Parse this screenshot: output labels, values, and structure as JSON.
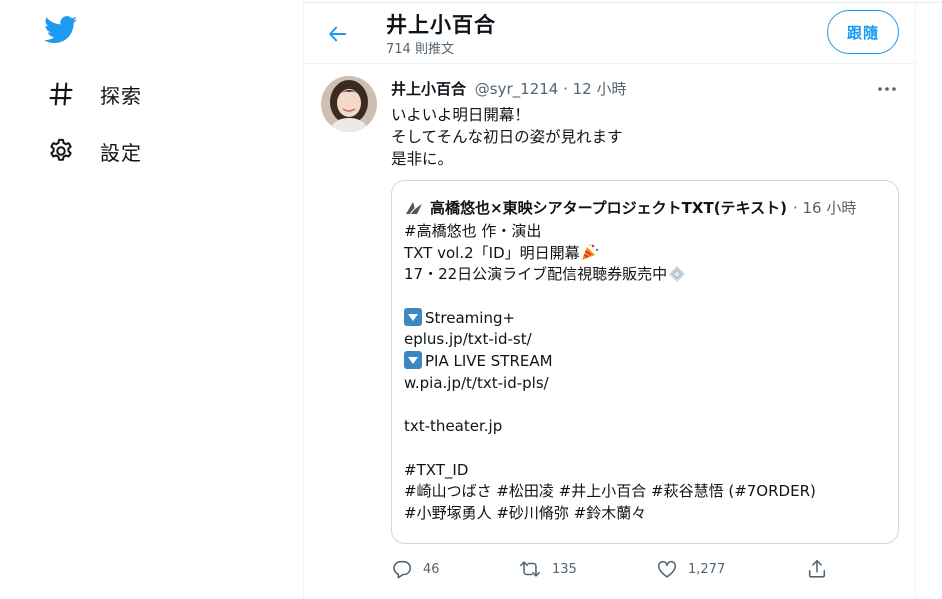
{
  "nav": {
    "logo_icon": "twitter-bird-icon",
    "items": [
      {
        "label": "探索",
        "icon": "hashtag-icon"
      },
      {
        "label": "設定",
        "icon": "gear-icon"
      }
    ]
  },
  "header": {
    "title": "井上小百合",
    "subtitle": "714 則推文",
    "follow_label": "跟隨",
    "back_icon": "arrow-left-icon"
  },
  "tweet": {
    "name": "井上小百合",
    "meta": "@syr_1214 · 12 小時",
    "more_icon": "more-horizontal-icon",
    "text_lines": [
      "いよいよ明日開幕！",
      "そしてそんな初日の姿が見れます",
      "是非に。"
    ],
    "quote": {
      "name": "高橋悠也×東映シアタープロジェクトTXT(テキスト)",
      "time": "· 16 小時",
      "lines": [
        "#高橋悠也 作・演出",
        "TXT vol.2「ID」明日開幕",
        "17・22日公演ライブ配信視聴券販売中",
        "",
        "Streaming+",
        "eplus.jp/txt-id-st/",
        "PIA LIVE STREAM",
        "w.pia.jp/t/txt-id-pls/",
        "",
        "txt-theater.jp",
        "",
        "#TXT_ID",
        "#崎山つばさ #松田凌 #井上小百合 #萩谷慧悟 (#7ORDER)",
        "#小野塚勇人 #砂川脩弥 #鈴木蘭々"
      ]
    },
    "actions": {
      "reply_count": "46",
      "retweet_count": "135",
      "like_count": "1,277"
    }
  },
  "colors": {
    "accent": "#1d9bf0",
    "text": "#0f1419",
    "muted": "#536471",
    "border": "#cfd9de"
  }
}
